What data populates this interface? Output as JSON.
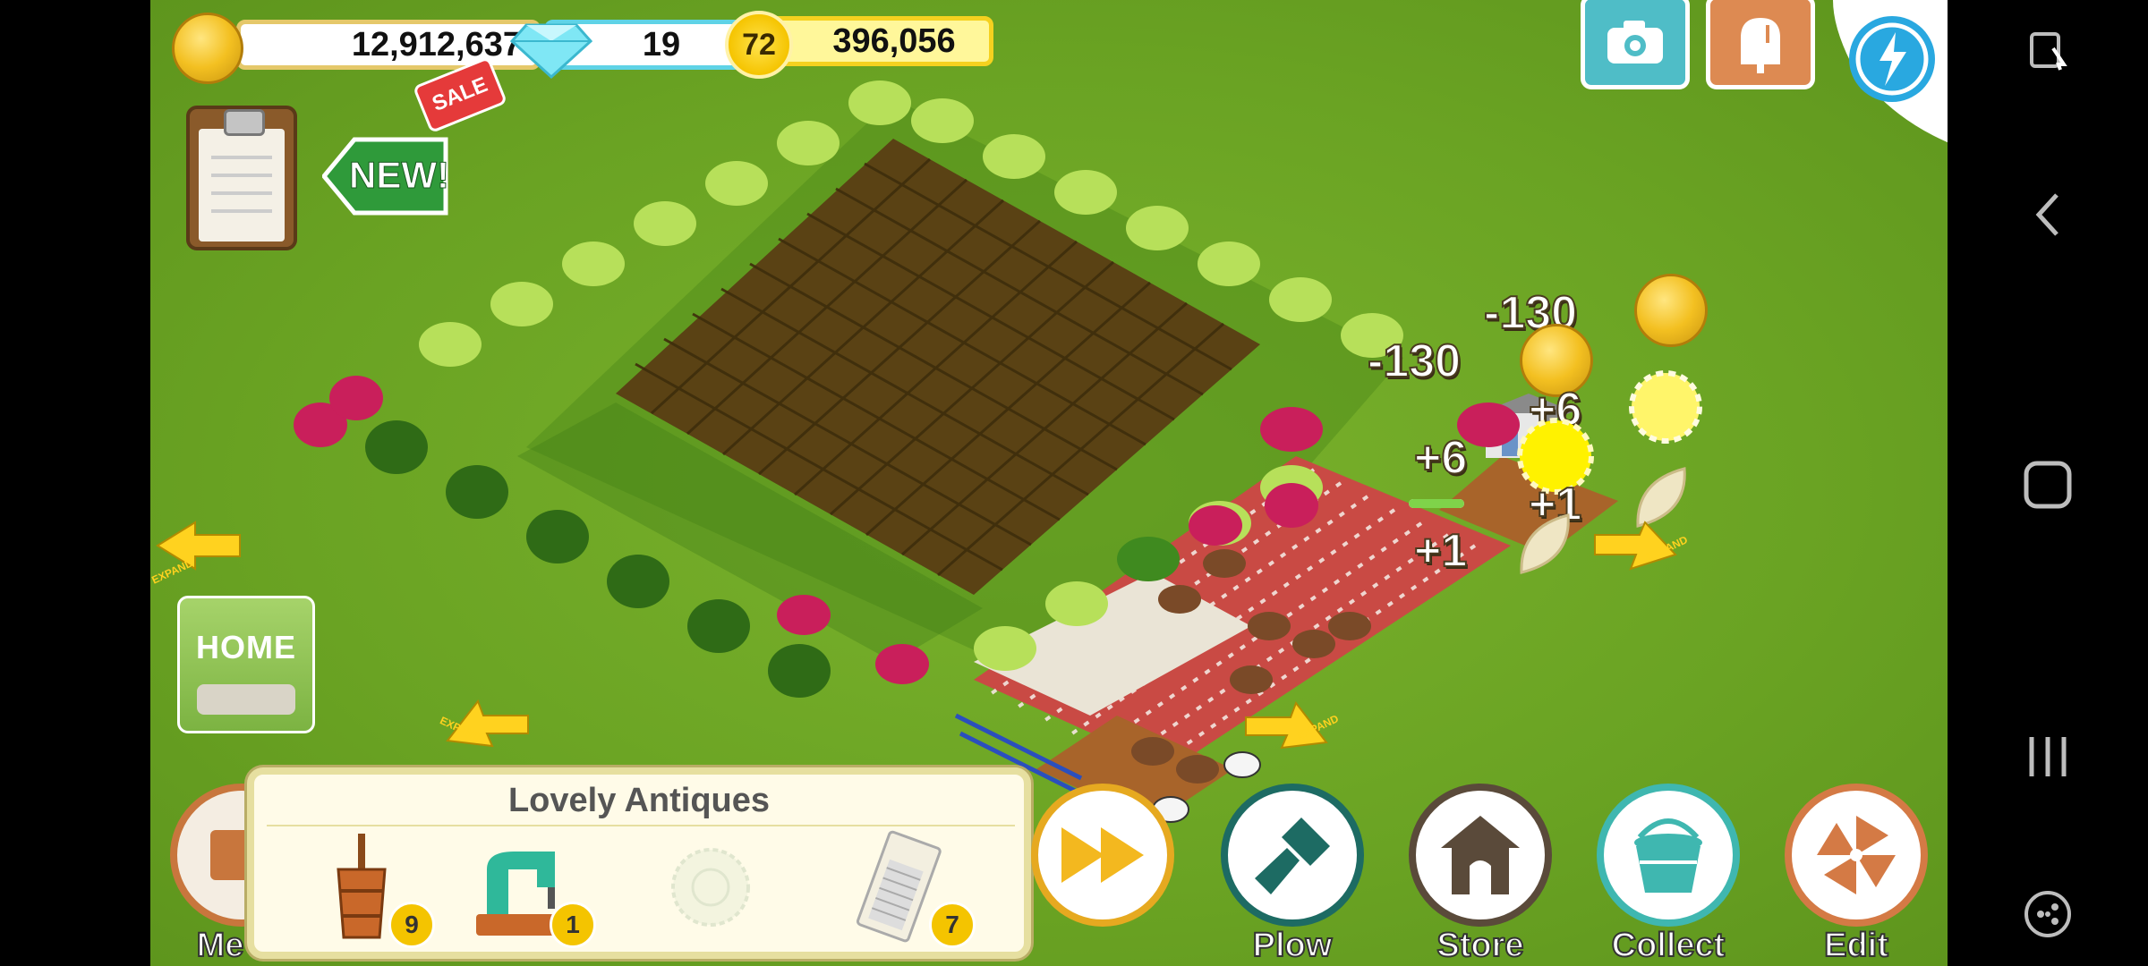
{
  "resources": {
    "coins": "12,912,637",
    "diamonds": "19",
    "level": "72",
    "experience": "396,056"
  },
  "badges": {
    "sale": "SALE",
    "new": "NEW!"
  },
  "home_button": {
    "label": "HOME"
  },
  "floating_rewards": [
    {
      "text": "-130",
      "icon": "coin-icon"
    },
    {
      "text": "-130",
      "icon": "coin-icon"
    },
    {
      "text": "+6",
      "icon": "xp-star-icon"
    },
    {
      "text": "+6",
      "icon": "xp-star-icon"
    },
    {
      "text": "+1",
      "icon": "seed-icon"
    },
    {
      "text": "+1",
      "icon": "seed-icon"
    }
  ],
  "expand_label": "EXPAND",
  "collection_panel": {
    "title": "Lovely Antiques",
    "items": [
      {
        "name": "butter-churn",
        "count": "9"
      },
      {
        "name": "sewing-machine",
        "count": "1"
      },
      {
        "name": "lace-doily",
        "count": ""
      },
      {
        "name": "washboard",
        "count": "7"
      }
    ]
  },
  "toolbar": {
    "menu": "Me",
    "plow": "Plow",
    "store": "Store",
    "collect": "Collect",
    "edit": "Edit"
  },
  "colors": {
    "grass": "#6aa323",
    "field": "#5a4214",
    "coin": "#f3c021",
    "diamond_border": "#5fd3e6",
    "plow_btn": "#1d6b63",
    "store_btn": "#5a4a3a",
    "collect_btn": "#3fb7b0",
    "edit_btn": "#d47a45",
    "ff_btn": "#f3b81f"
  }
}
